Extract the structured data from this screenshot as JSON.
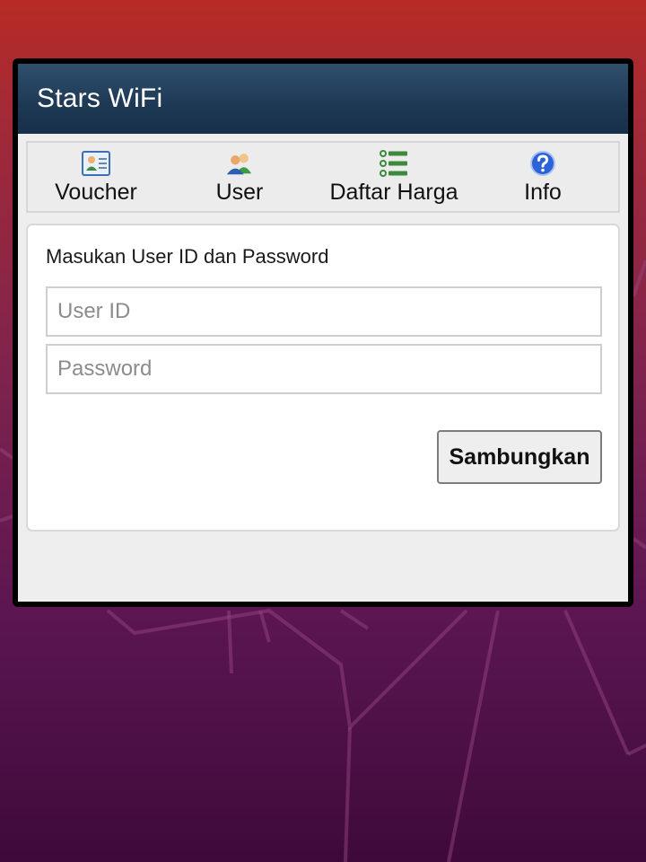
{
  "window": {
    "title": "Stars WiFi"
  },
  "nav": {
    "items": [
      {
        "label": "Voucher",
        "icon": "voucher-card-icon"
      },
      {
        "label": "User",
        "icon": "users-icon"
      },
      {
        "label": "Daftar Harga",
        "icon": "list-icon"
      },
      {
        "label": "Info",
        "icon": "help-icon"
      }
    ]
  },
  "login": {
    "prompt": "Masukan User ID dan Password",
    "user_id_placeholder": "User ID",
    "user_id_value": "",
    "password_placeholder": "Password",
    "password_value": "",
    "submit_label": "Sambungkan"
  },
  "colors": {
    "titlebar": "#1f3a56",
    "nav_background": "#ececec",
    "wallpaper_top": "#b72b24",
    "wallpaper_bottom": "#3e0a3a"
  }
}
